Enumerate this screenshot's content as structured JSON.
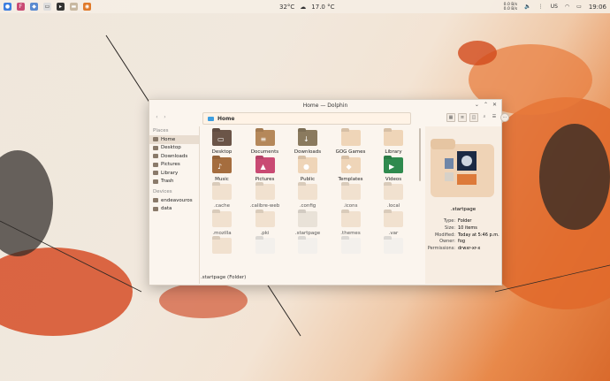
{
  "panel": {
    "center": {
      "temp": "32°C",
      "weather": "17.0 °C"
    },
    "net": {
      "up": "0.0 B/s",
      "down": "0.0 B/s"
    },
    "layout": "US",
    "time": "19:06"
  },
  "window": {
    "title": "Home — Dolphin",
    "path_label": "Home"
  },
  "sidebar": {
    "places_header": "Places",
    "places": [
      {
        "label": "Home",
        "active": true
      },
      {
        "label": "Desktop"
      },
      {
        "label": "Downloads"
      },
      {
        "label": "Pictures"
      },
      {
        "label": "Library"
      },
      {
        "label": "Trash"
      }
    ],
    "devices_header": "Devices",
    "devices": [
      {
        "label": "endeavouros"
      },
      {
        "label": "data"
      }
    ]
  },
  "files": [
    {
      "label": "Desktop",
      "color": "#6b5548",
      "glyph": "▭"
    },
    {
      "label": "Documents",
      "color": "#b5885a",
      "glyph": "≡"
    },
    {
      "label": "Downloads",
      "color": "#8a7a5e",
      "glyph": "↓"
    },
    {
      "label": "GOG Games",
      "color": "#efd5b8",
      "glyph": ""
    },
    {
      "label": "Library",
      "color": "#efd5b8",
      "glyph": ""
    },
    {
      "label": "Music",
      "color": "#a56d3e",
      "glyph": "♪"
    },
    {
      "label": "Pictures",
      "color": "#c94a73",
      "glyph": "▲"
    },
    {
      "label": "Public",
      "color": "#efd5b8",
      "glyph": "●"
    },
    {
      "label": "Templates",
      "color": "#efd5b8",
      "glyph": "◆"
    },
    {
      "label": "Videos",
      "color": "#2f8a4e",
      "glyph": "▶"
    },
    {
      "label": ".cache",
      "color": "#f1e1cf",
      "glyph": ""
    },
    {
      "label": ".calibre-web",
      "color": "#f1e1cf",
      "glyph": ""
    },
    {
      "label": ".config",
      "color": "#f1e1cf",
      "glyph": ""
    },
    {
      "label": ".icons",
      "color": "#f1e1cf",
      "glyph": ""
    },
    {
      "label": ".local",
      "color": "#f1e1cf",
      "glyph": ""
    },
    {
      "label": ".mozilla",
      "color": "#f1e1cf",
      "glyph": ""
    },
    {
      "label": ".pki",
      "color": "#f1e1cf",
      "glyph": ""
    },
    {
      "label": ".startpage",
      "color": "#e9e2d8",
      "glyph": ""
    },
    {
      "label": ".themes",
      "color": "#f1e1cf",
      "glyph": ""
    },
    {
      "label": ".var",
      "color": "#f1e1cf",
      "glyph": ""
    },
    {
      "label": "",
      "color": "#f1e1cf",
      "glyph": ""
    },
    {
      "label": "",
      "color": "#f3f0ec",
      "glyph": ""
    },
    {
      "label": "",
      "color": "#f3f0ec",
      "glyph": ""
    },
    {
      "label": "",
      "color": "#f3f0ec",
      "glyph": ""
    },
    {
      "label": "",
      "color": "#f3f0ec",
      "glyph": ""
    }
  ],
  "status": ".startpage (Folder)",
  "info": {
    "name": ".startpage",
    "rows": [
      {
        "k": "Type:",
        "v": "Folder"
      },
      {
        "k": "Size:",
        "v": "10 items"
      },
      {
        "k": "Modified:",
        "v": "Today at 5:46 p.m."
      },
      {
        "k": "Owner:",
        "v": "fog"
      },
      {
        "k": "Permissions:",
        "v": "drwxr-xr-x"
      }
    ]
  }
}
